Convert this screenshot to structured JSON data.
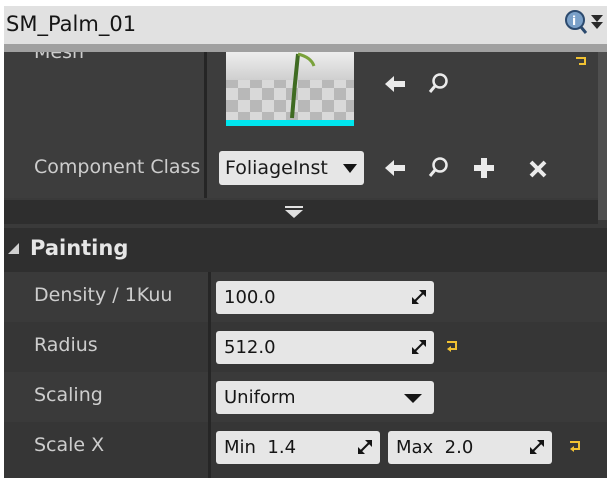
{
  "title": "SM_Palm_01",
  "title_icons": [
    "search-info-icon",
    "filter-icon"
  ],
  "mesh": {
    "label": "Mesh"
  },
  "component_class": {
    "label": "Component Class",
    "value": "FoliageInst"
  },
  "painting": {
    "section_label": "Painting",
    "density": {
      "label": "Density / 1Kuu",
      "value": "100.0"
    },
    "radius": {
      "label": "Radius",
      "value": "512.0"
    },
    "scaling": {
      "label": "Scaling",
      "value": "Uniform"
    },
    "scale_x": {
      "label": "Scale X",
      "min_label": "Min",
      "min_value": "1.4",
      "max_label": "Max",
      "max_value": "2.0"
    }
  },
  "colors": {
    "reset_arrow": "#f1c232",
    "thumbnail_bar": "#00e5ee"
  }
}
